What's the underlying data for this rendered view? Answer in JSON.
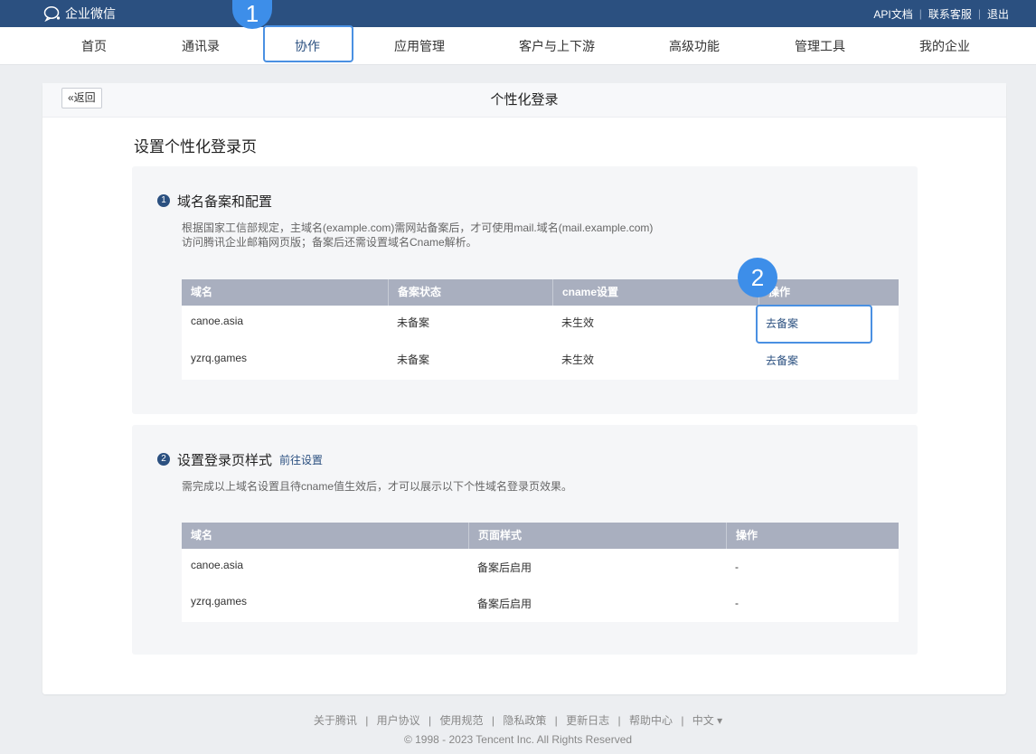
{
  "app": {
    "logo_text": "企业微信"
  },
  "top_links": [
    "API文档",
    "联系客服",
    "退出"
  ],
  "nav": [
    "首页",
    "通讯录",
    "协作",
    "应用管理",
    "客户与上下游",
    "高级功能",
    "管理工具",
    "我的企业"
  ],
  "annotations": [
    "1",
    "2"
  ],
  "page": {
    "back_label": "«返回",
    "title": "个性化登录",
    "heading": "设置个性化登录页"
  },
  "section1": {
    "num": "1",
    "title": "域名备案和配置",
    "desc_line1": "根据国家工信部规定，主域名(example.com)需网站备案后，才可使用mail.域名(mail.example.com)",
    "desc_line2": "访问腾讯企业邮箱网页版；备案后还需设置域名Cname解析。",
    "headers": [
      "域名",
      "备案状态",
      "cname设置",
      "操作"
    ],
    "rows": [
      [
        "canoe.asia",
        "未备案",
        "未生效",
        "去备案"
      ],
      [
        "yzrq.games",
        "未备案",
        "未生效",
        "去备案"
      ]
    ]
  },
  "section2": {
    "num": "2",
    "title": "设置登录页样式",
    "link": "前往设置",
    "desc": "需完成以上域名设置且待cname值生效后，才可以展示以下个性域名登录页效果。",
    "headers": [
      "域名",
      "页面样式",
      "操作"
    ],
    "rows": [
      [
        "canoe.asia",
        "备案后启用",
        "-"
      ],
      [
        "yzrq.games",
        "备案后启用",
        "-"
      ]
    ]
  },
  "footer": {
    "links": [
      "关于腾讯",
      "用户协议",
      "使用规范",
      "隐私政策",
      "更新日志",
      "帮助中心",
      "中文 ▾"
    ],
    "copyright": "© 1998 - 2023 Tencent Inc. All Rights Reserved"
  }
}
